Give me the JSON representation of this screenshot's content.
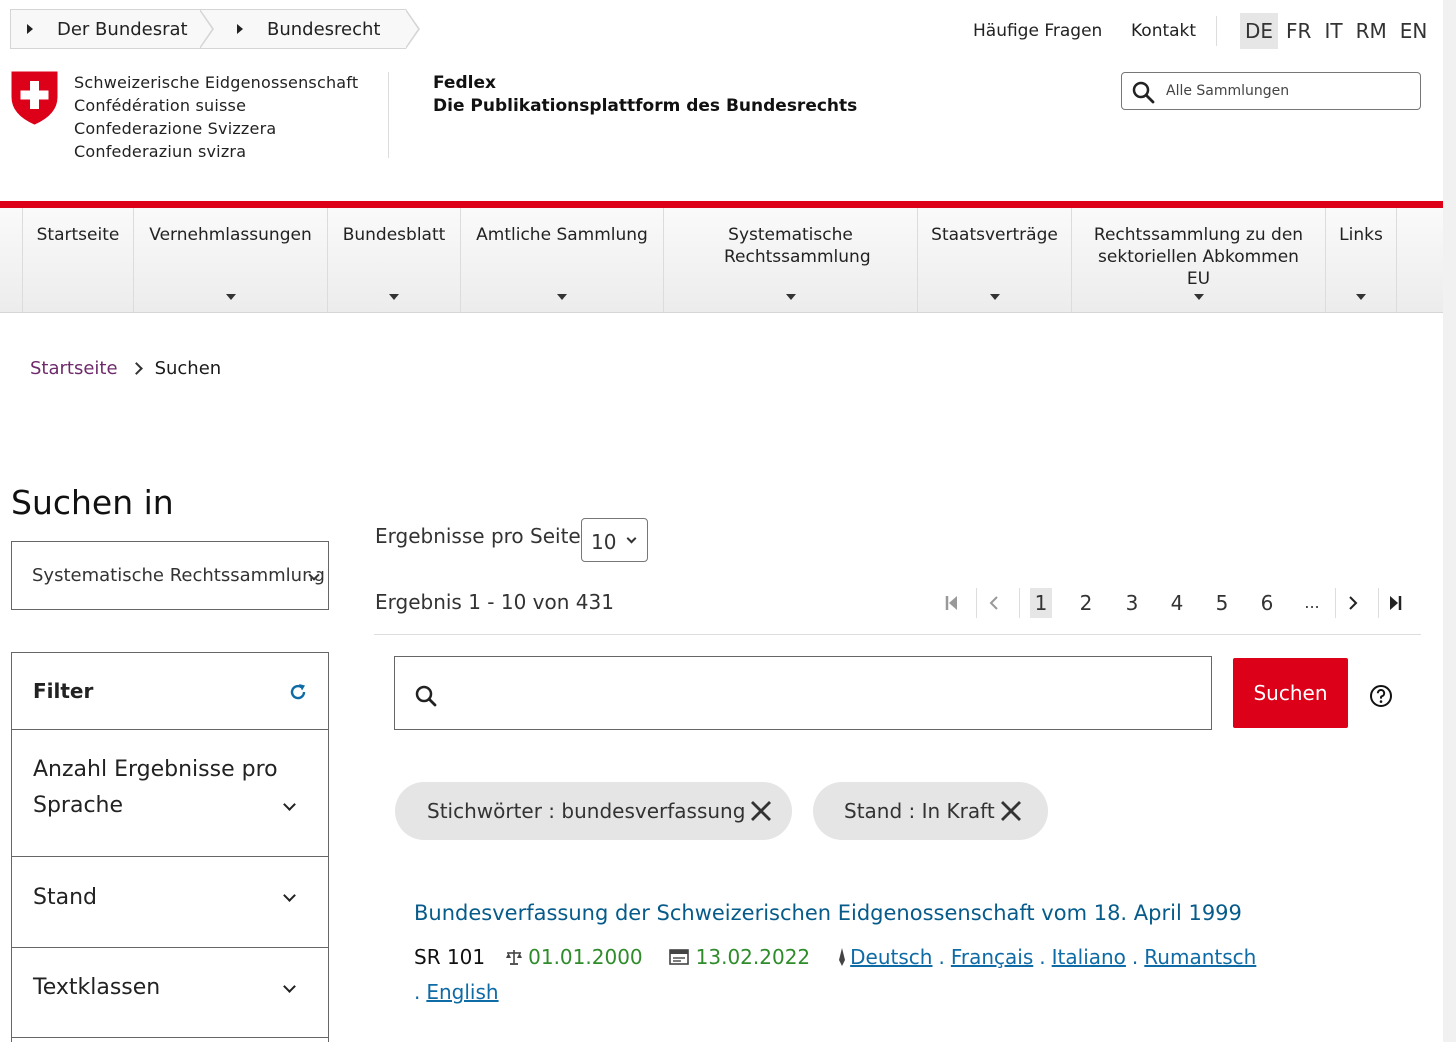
{
  "top_breadcrumb": [
    "Der Bundesrat",
    "Bundesrecht"
  ],
  "top_links": {
    "faq": "Häufige Fragen",
    "contact": "Kontakt"
  },
  "languages": [
    "DE",
    "FR",
    "IT",
    "RM",
    "EN"
  ],
  "active_language": "DE",
  "confederation": [
    "Schweizerische Eidgenossenschaft",
    "Confédération suisse",
    "Confederazione Svizzera",
    "Confederaziun svizra"
  ],
  "site": {
    "name": "Fedlex",
    "subtitle": "Die Publikationsplattform des Bundesrechts"
  },
  "header_search": {
    "placeholder": "Alle Sammlungen"
  },
  "nav": [
    "Startseite",
    "Vernehmlassungen",
    "Bundesblatt",
    "Amtliche Sammlung",
    "Systematische Rechtssammlung",
    "Staatsverträge",
    "Rechtssammlung zu den sektoriellen Abkommen EU",
    "Links"
  ],
  "breadcrumb": {
    "home": "Startseite",
    "current": "Suchen"
  },
  "sidebar": {
    "title": "Suchen in",
    "collection": "Systematische Rechtssammlung",
    "filter_title": "Filter",
    "filters": [
      "Anzahl Ergebnisse pro Sprache",
      "Stand",
      "Textklassen"
    ]
  },
  "results": {
    "per_page_label": "Ergebnisse pro Seite",
    "per_page_value": "10",
    "count_text": "Ergebnis 1 - 10 von 431",
    "pages": [
      "1",
      "2",
      "3",
      "4",
      "5",
      "6",
      "..."
    ],
    "current_page": "1"
  },
  "search": {
    "value": "",
    "button": "Suchen"
  },
  "chips": [
    "Stichwörter : bundesverfassung",
    "Stand : In Kraft"
  ],
  "result_items": [
    {
      "title": "Bundesverfassung der Schweizerischen Eidgenossenschaft vom 18. April 1999",
      "sr": "SR 101",
      "date_in_force": "01.01.2000",
      "date_version": "13.02.2022",
      "languages": [
        "Deutsch",
        "Français",
        "Italiano",
        "Rumantsch",
        "English"
      ]
    }
  ],
  "colors": {
    "accent_red": "#dc0018",
    "link_blue": "#0f6ba6",
    "date_green": "#2f8c2a",
    "crumb_purple": "#6e2a6a"
  }
}
